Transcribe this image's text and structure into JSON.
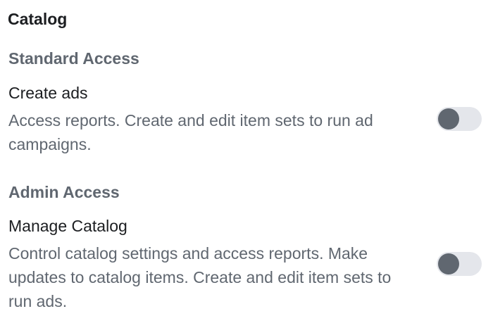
{
  "section": {
    "title": "Catalog"
  },
  "groups": [
    {
      "heading": "Standard Access",
      "permission": {
        "title": "Create ads",
        "description": "Access reports. Create and edit item sets to run ad campaigns.",
        "enabled": false
      }
    },
    {
      "heading": "Admin Access",
      "permission": {
        "title": "Manage Catalog",
        "description": "Control catalog settings and access reports. Make updates to catalog items. Create and edit item sets to run ads.",
        "enabled": false
      }
    }
  ],
  "colors": {
    "toggle_track": "#e4e6eb",
    "toggle_knob": "#606770",
    "secondary_text": "#606770",
    "primary_text": "#1c1e21"
  }
}
